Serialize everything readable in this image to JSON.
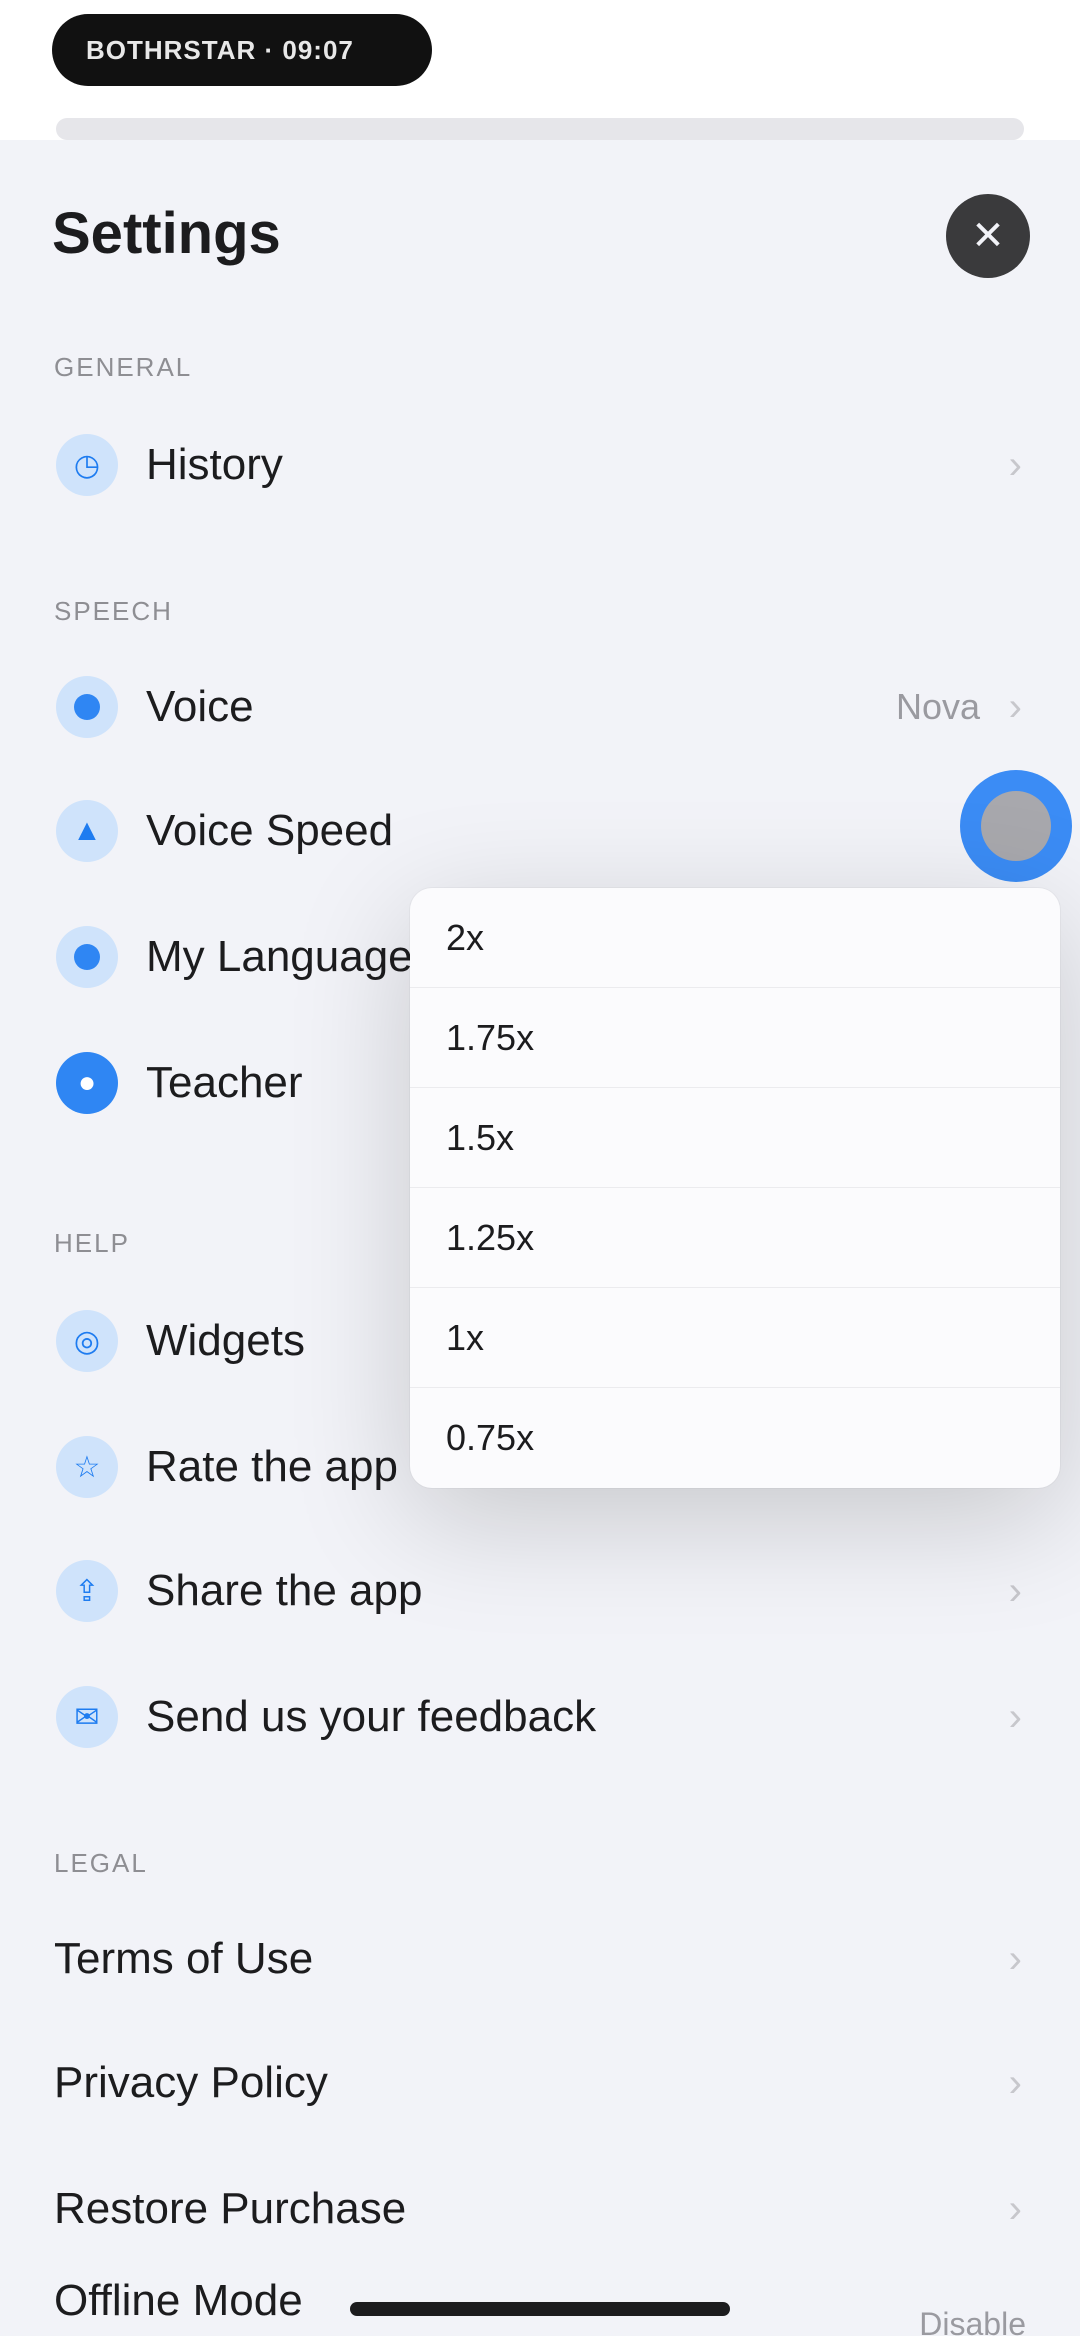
{
  "status": {
    "pill_text": "BOTHRSTAR · 09:07"
  },
  "header": {
    "title": "Settings",
    "close_icon": "close-icon"
  },
  "sections": {
    "general": "GENERAL",
    "speech": "SPEECH",
    "help": "HELP",
    "legal": "LEGAL"
  },
  "general_items": [
    {
      "label": "History",
      "icon": "clock-icon"
    }
  ],
  "speech_items": [
    {
      "label": "Voice",
      "value": "Nova",
      "icon": "waveform-icon"
    },
    {
      "label": "Voice Speed",
      "icon": "speed-icon"
    },
    {
      "label": "My Language",
      "icon": "globe-icon"
    },
    {
      "label": "Teacher",
      "icon": "chat-bubble-icon"
    }
  ],
  "help_items": [
    {
      "label": "Widgets",
      "icon": "widget-icon"
    },
    {
      "label": "Rate the app",
      "icon": "star-icon"
    },
    {
      "label": "Share the app",
      "icon": "share-icon"
    },
    {
      "label": "Send us your feedback",
      "icon": "mail-icon"
    }
  ],
  "legal_items": [
    {
      "label": "Terms of Use"
    },
    {
      "label": "Privacy Policy"
    },
    {
      "label": "Restore Purchase"
    },
    {
      "label": "Offline Mode",
      "value": "Disable"
    }
  ],
  "speed_menu": {
    "options": [
      "2x",
      "1.75x",
      "1.5x",
      "1.25x",
      "1x",
      "0.75x"
    ]
  },
  "colors": {
    "accent": "#2f86f3",
    "background": "#f2f3f8",
    "icon_bg": "#cfe3fb"
  }
}
